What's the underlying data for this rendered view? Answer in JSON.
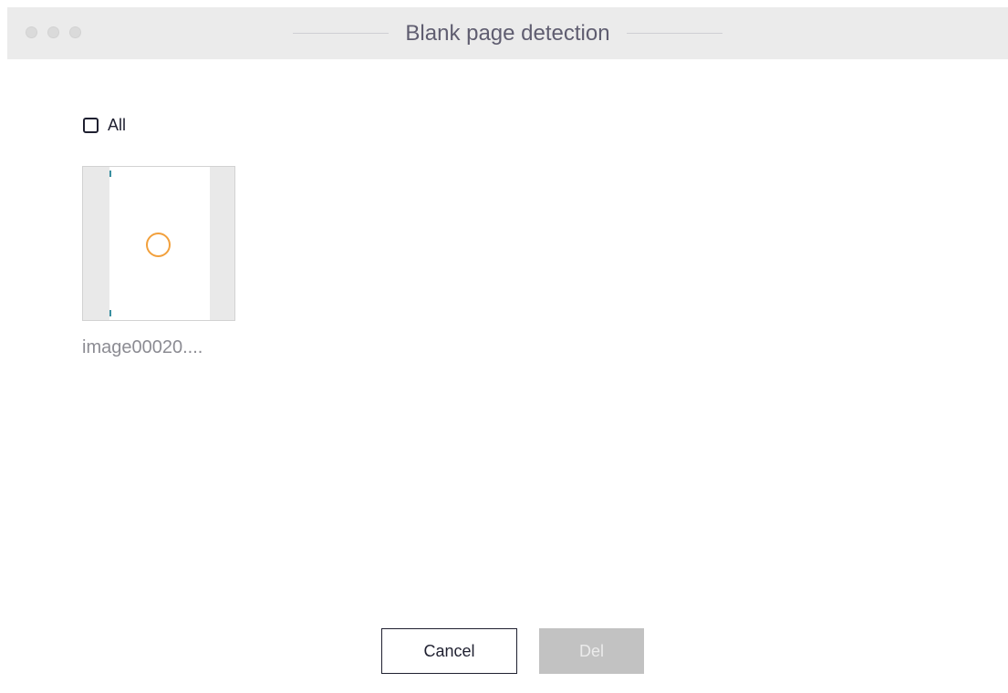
{
  "window": {
    "title": "Blank page detection"
  },
  "selection": {
    "all_label": "All",
    "all_checked": false
  },
  "thumbnails": [
    {
      "name": "image00020....",
      "selected": false
    }
  ],
  "buttons": {
    "cancel_label": "Cancel",
    "del_label": "Del",
    "del_enabled": false
  },
  "colors": {
    "titlebar_bg": "#ebebeb",
    "title_text": "#5f5d70",
    "radio_accent": "#f2a03c",
    "disabled_button_bg": "#c2c2c2",
    "text_dark": "#1f2030"
  },
  "icons": {
    "window_controls": [
      "close-icon",
      "minimize-icon",
      "zoom-icon"
    ],
    "checkbox": "checkbox-icon",
    "thumbnail_selector": "radio-circle-icon"
  }
}
